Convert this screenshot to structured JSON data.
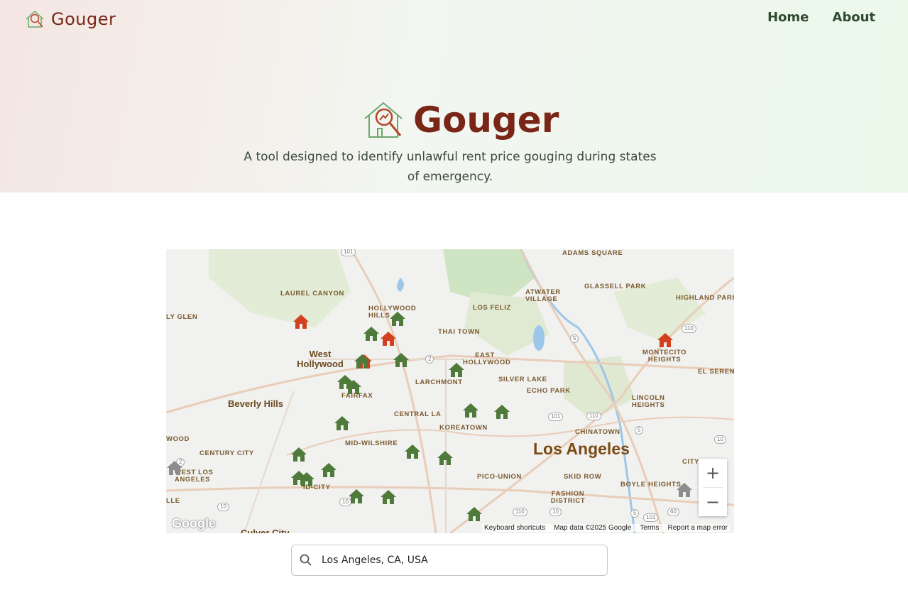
{
  "header": {
    "brand_name": "Gouger",
    "nav": [
      {
        "label": "Home"
      },
      {
        "label": "About"
      }
    ]
  },
  "hero": {
    "title": "Gouger",
    "subtitle": "A tool designed to identify unlawful rent price gouging during states of emergency."
  },
  "map": {
    "labels": {
      "adams_square": "ADAMS SQUARE",
      "laurel_canyon": "LAUREL CANYON",
      "hollywood_hills": "HOLLYWOOD HILLS",
      "los_feliz": "LOS FELIZ",
      "atwater": "ATWATER VILLAGE",
      "glassell": "GLASSELL PARK",
      "highland_park": "HIGHLAND PARK",
      "glen": "LY GLEN",
      "thai_town": "THAI TOWN",
      "west_hollywood": "West Hollywood",
      "east_hollywood": "EAST HOLLYWOOD",
      "montecito": "MONTECITO HEIGHTS",
      "el_sereno": "EL SERENO",
      "larchmont": "LARCHMONT",
      "silver_lake": "SILVER LAKE",
      "echo_park": "ECHO PARK",
      "fairfax": "FAIRFAX",
      "beverly_hills": "Beverly Hills",
      "lincoln_heights": "LINCOLN HEIGHTS",
      "central_la": "CENTRAL LA",
      "koreatown": "KOREATOWN",
      "chinatown": "CHINATOWN",
      "wood": "WOOD",
      "century_city": "CENTURY CITY",
      "mid_wilshire": "MID-WILSHIRE",
      "los_angeles": "Los Angeles",
      "west_la": "WEST LOS ANGELES",
      "pico_union": "PICO-UNION",
      "skid_row": "SKID ROW",
      "boyle_heights": "BOYLE HEIGHTS",
      "city": "CITY",
      "mid_city": "ID-CITY",
      "fashion": "FASHION DISTRICT",
      "lle": "LLE",
      "culver_city": "Culver City"
    },
    "markers": [
      {
        "status": "flagged"
      },
      {
        "status": "flagged"
      },
      {
        "status": "flagged"
      },
      {
        "status": "flagged"
      },
      {
        "status": "ok"
      },
      {
        "status": "ok"
      },
      {
        "status": "ok"
      },
      {
        "status": "ok"
      },
      {
        "status": "ok"
      },
      {
        "status": "ok"
      },
      {
        "status": "ok"
      },
      {
        "status": "ok"
      },
      {
        "status": "ok"
      },
      {
        "status": "ok"
      },
      {
        "status": "ok"
      },
      {
        "status": "ok"
      },
      {
        "status": "ok"
      },
      {
        "status": "ok"
      },
      {
        "status": "ok"
      },
      {
        "status": "ok"
      },
      {
        "status": "ok"
      },
      {
        "status": "ok"
      },
      {
        "status": "ok"
      },
      {
        "status": "unknown"
      },
      {
        "status": "unknown"
      }
    ],
    "marker_colors": {
      "flagged": "#d2401f",
      "ok": "#4e7a3a",
      "unknown": "#8d8d8d"
    },
    "controls": {
      "zoom_in": "+",
      "zoom_out": "−"
    },
    "attribution": {
      "logo": "Google",
      "keyboard": "Keyboard shortcuts",
      "map_data": "Map data ©2025 Google",
      "terms": "Terms",
      "report": "Report a map error"
    }
  },
  "search": {
    "value": "Los Angeles, CA, USA",
    "icon": "search-icon"
  },
  "colors": {
    "brand": "#7a2617",
    "nav": "#2f4a30"
  }
}
